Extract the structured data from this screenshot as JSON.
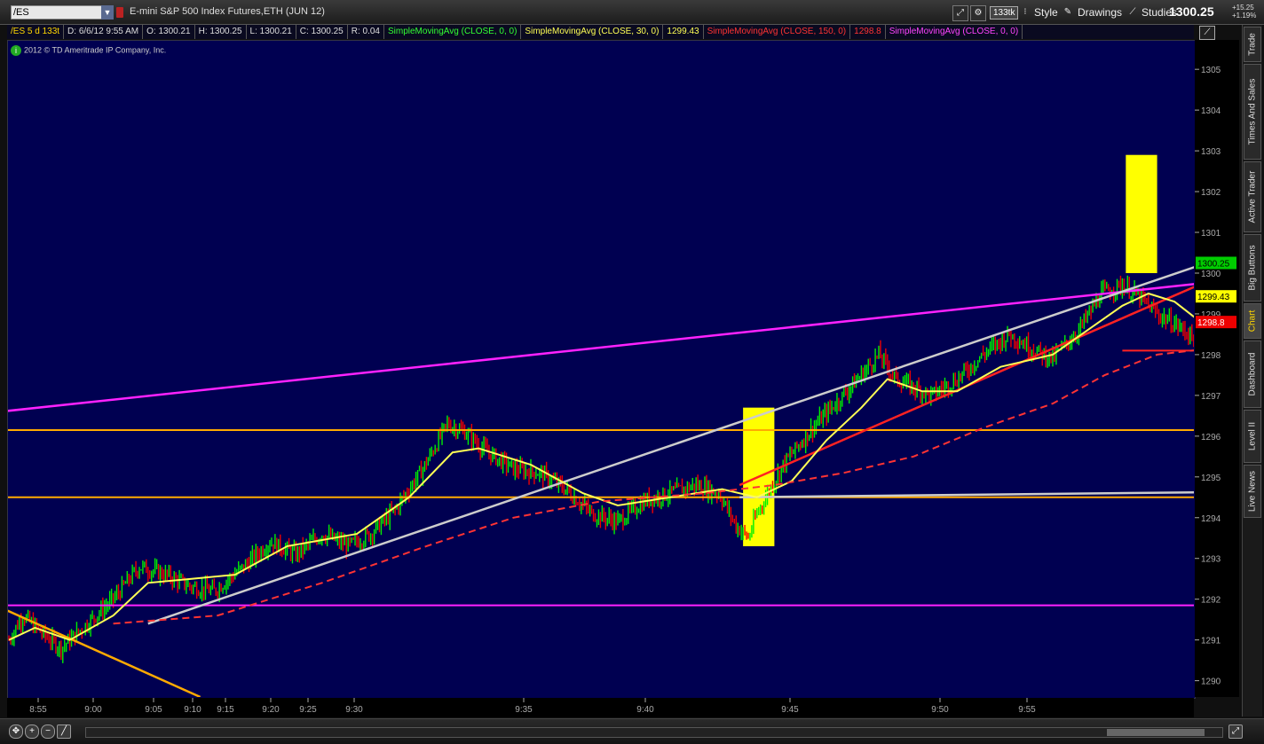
{
  "toolbar": {
    "symbol": "/ES",
    "instrument_name": "E-mini S&P 500 Index Futures,ETH (JUN 12)",
    "tick_badge": "133tk",
    "style_label": "Style",
    "drawings_label": "Drawings",
    "studies_label": "Studies",
    "last_price": "1300.25",
    "net_change": "+15.25",
    "pct_change": "+1.19%"
  },
  "info_bar": {
    "symbol_period": "/ES 5 d 133t",
    "date": "D: 6/6/12 9:55 AM",
    "open": "O: 1300.21",
    "high": "H: 1300.25",
    "low": "L: 1300.21",
    "close": "C: 1300.25",
    "range": "R: 0.04",
    "studies": [
      {
        "label": "SimpleMovingAvg (CLOSE, 0, 0)",
        "color": "#33ff33",
        "value": ""
      },
      {
        "label": "SimpleMovingAvg (CLOSE, 30, 0)",
        "color": "#ffff55",
        "value": "1299.43"
      },
      {
        "label": "SimpleMovingAvg (CLOSE, 150, 0)",
        "color": "#ff3333",
        "value": "1298.8"
      },
      {
        "label": "SimpleMovingAvg (CLOSE, 0, 0)",
        "color": "#ff44ff",
        "value": ""
      }
    ]
  },
  "copyright": "2012 © TD Ameritrade IP Company, Inc.",
  "sidebar_tabs": [
    {
      "label": "Trade",
      "active": false
    },
    {
      "label": "Times And Sales",
      "active": false
    },
    {
      "label": "Active Trader",
      "active": false
    },
    {
      "label": "Big Buttons",
      "active": false
    },
    {
      "label": "Chart",
      "active": true
    },
    {
      "label": "Dashboard",
      "active": false
    },
    {
      "label": "Level II",
      "active": false
    },
    {
      "label": "Live News",
      "active": false
    }
  ],
  "chart_data": {
    "type": "bar",
    "title": "E-mini S&P 500 Index Futures,ETH (JUN 12)",
    "ylim": [
      1289.6,
      1305.7
    ],
    "y_ticks": [
      1290,
      1291,
      1292,
      1293,
      1294,
      1295,
      1296,
      1297,
      1298,
      1299,
      1300,
      1301,
      1302,
      1303,
      1304,
      1305
    ],
    "x_ticks": [
      "8:55",
      "9:00",
      "9:05",
      "9:10",
      "9:15",
      "9:20",
      "9:25",
      "9:30",
      "9:35",
      "9:40",
      "9:45",
      "9:50",
      "9:55"
    ],
    "grid": false,
    "colors": {
      "up": "#00ee00",
      "down": "#ee0000",
      "background": "#000051"
    },
    "price_path_by_bar": [
      [
        0,
        1291.0
      ],
      [
        8,
        1291.6
      ],
      [
        18,
        1291.2
      ],
      [
        30,
        1290.8
      ],
      [
        45,
        1291.4
      ],
      [
        60,
        1292.0
      ],
      [
        75,
        1292.8
      ],
      [
        90,
        1292.6
      ],
      [
        105,
        1292.3
      ],
      [
        118,
        1292.2
      ],
      [
        135,
        1292.8
      ],
      [
        150,
        1293.4
      ],
      [
        165,
        1293.1
      ],
      [
        180,
        1293.6
      ],
      [
        195,
        1293.3
      ],
      [
        208,
        1293.6
      ],
      [
        222,
        1294.2
      ],
      [
        238,
        1295.2
      ],
      [
        252,
        1296.3
      ],
      [
        262,
        1296.1
      ],
      [
        275,
        1295.6
      ],
      [
        290,
        1295.2
      ],
      [
        305,
        1295.1
      ],
      [
        320,
        1294.7
      ],
      [
        335,
        1294.1
      ],
      [
        350,
        1293.9
      ],
      [
        365,
        1294.4
      ],
      [
        380,
        1294.6
      ],
      [
        395,
        1294.8
      ],
      [
        408,
        1294.6
      ],
      [
        418,
        1293.8
      ],
      [
        425,
        1293.5
      ],
      [
        430,
        1294.1
      ],
      [
        445,
        1295.3
      ],
      [
        460,
        1296.1
      ],
      [
        475,
        1296.8
      ],
      [
        490,
        1297.5
      ],
      [
        500,
        1298.0
      ],
      [
        510,
        1297.4
      ],
      [
        520,
        1297.2
      ],
      [
        530,
        1297.0
      ],
      [
        545,
        1297.4
      ],
      [
        560,
        1298.0
      ],
      [
        575,
        1298.5
      ],
      [
        590,
        1298.1
      ],
      [
        600,
        1297.9
      ],
      [
        615,
        1298.6
      ],
      [
        628,
        1299.5
      ],
      [
        640,
        1299.7
      ],
      [
        650,
        1299.4
      ],
      [
        660,
        1299.0
      ],
      [
        672,
        1298.7
      ],
      [
        685,
        1298.3
      ],
      [
        700,
        1298.4
      ],
      [
        715,
        1298.6
      ],
      [
        725,
        1299.3
      ],
      [
        735,
        1300.1
      ],
      [
        745,
        1300.25
      ]
    ],
    "studies": [
      {
        "name": "SimpleMovingAvg (CLOSE, 30, 0)",
        "color": "#ffff55",
        "style": "solid",
        "points": [
          [
            0,
            1291.0
          ],
          [
            15,
            1291.3
          ],
          [
            35,
            1291.0
          ],
          [
            60,
            1291.6
          ],
          [
            80,
            1292.4
          ],
          [
            105,
            1292.5
          ],
          [
            130,
            1292.6
          ],
          [
            160,
            1293.3
          ],
          [
            200,
            1293.6
          ],
          [
            230,
            1294.5
          ],
          [
            255,
            1295.6
          ],
          [
            270,
            1295.7
          ],
          [
            300,
            1295.3
          ],
          [
            330,
            1294.6
          ],
          [
            350,
            1294.3
          ],
          [
            380,
            1294.5
          ],
          [
            410,
            1294.7
          ],
          [
            430,
            1294.5
          ],
          [
            450,
            1294.9
          ],
          [
            470,
            1295.9
          ],
          [
            490,
            1296.7
          ],
          [
            505,
            1297.4
          ],
          [
            525,
            1297.1
          ],
          [
            545,
            1297.1
          ],
          [
            570,
            1297.7
          ],
          [
            600,
            1298.0
          ],
          [
            620,
            1298.6
          ],
          [
            640,
            1299.2
          ],
          [
            655,
            1299.5
          ],
          [
            670,
            1299.3
          ],
          [
            685,
            1298.8
          ],
          [
            700,
            1298.6
          ],
          [
            715,
            1298.5
          ],
          [
            730,
            1298.7
          ],
          [
            745,
            1299.0
          ],
          [
            755,
            1299.43
          ]
        ]
      },
      {
        "name": "SimpleMovingAvg (CLOSE, 150, 0)",
        "color": "#ff3333",
        "style": "dashed",
        "points": [
          [
            60,
            1291.4
          ],
          [
            120,
            1291.6
          ],
          [
            180,
            1292.4
          ],
          [
            240,
            1293.3
          ],
          [
            290,
            1294.0
          ],
          [
            340,
            1294.4
          ],
          [
            400,
            1294.6
          ],
          [
            440,
            1294.8
          ],
          [
            480,
            1295.1
          ],
          [
            520,
            1295.5
          ],
          [
            560,
            1296.2
          ],
          [
            600,
            1296.8
          ],
          [
            630,
            1297.5
          ],
          [
            660,
            1298.0
          ],
          [
            700,
            1298.2
          ],
          [
            740,
            1298.5
          ],
          [
            755,
            1298.8
          ]
        ]
      }
    ],
    "horizontal_lines": [
      {
        "price": 1296.15,
        "color": "#ffaa00"
      },
      {
        "price": 1294.5,
        "color": "#ffaa00"
      },
      {
        "price": 1291.85,
        "color": "#ff22ff"
      },
      {
        "price": 1298.1,
        "color": "#ff2222",
        "from_bar": 640
      }
    ],
    "trendlines": [
      {
        "color": "#ff22ff",
        "from": [
          -5,
          1296.6
        ],
        "to": [
          850,
          1300.5
        ]
      },
      {
        "color": "#cccccc",
        "from": [
          80,
          1291.4
        ],
        "to": [
          850,
          1302.6
        ]
      },
      {
        "color": "#cccccc",
        "from": [
          420,
          1294.5
        ],
        "to": [
          850,
          1294.7
        ]
      },
      {
        "color": "#ff2222",
        "from": [
          420,
          1294.8
        ],
        "to": [
          850,
          1302.8
        ]
      },
      {
        "color": "#ffaa00",
        "from": [
          -5,
          1291.8
        ],
        "to": [
          110,
          1289.6
        ]
      }
    ],
    "highlight_boxes": [
      {
        "from_bar": 422,
        "to_bar": 440,
        "low": 1293.3,
        "high": 1296.7,
        "color": "#ffff00"
      },
      {
        "from_bar": 642,
        "to_bar": 660,
        "low": 1300.0,
        "high": 1302.9,
        "color": "#ffff00"
      }
    ],
    "price_labels": [
      {
        "price": 1300.25,
        "text": "1300.25",
        "bg": "#00cc00",
        "fg": "#000000"
      },
      {
        "price": 1299.43,
        "text": "1299.43",
        "bg": "#ffff00",
        "fg": "#000000"
      },
      {
        "price": 1298.8,
        "text": "1298.8",
        "bg": "#ee0000",
        "fg": "#ffffff"
      }
    ]
  }
}
